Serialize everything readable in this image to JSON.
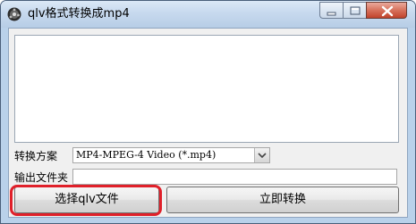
{
  "window": {
    "title": "qlv格式转换成mp4"
  },
  "main": {
    "log_text": "",
    "format_label": "转换方案",
    "format_value": "MP4-MPEG-4 Video (*.mp4)",
    "output_folder_label": "输出文件夹",
    "output_folder_value": "",
    "select_button_label": "选择qlv文件",
    "convert_button_label": "立即转换"
  },
  "colors": {
    "highlight": "#e0202a",
    "close_button": "#c0432b"
  },
  "icons": [
    "app-icon",
    "minimize-icon",
    "maximize-icon",
    "close-icon",
    "chevron-down-icon"
  ]
}
